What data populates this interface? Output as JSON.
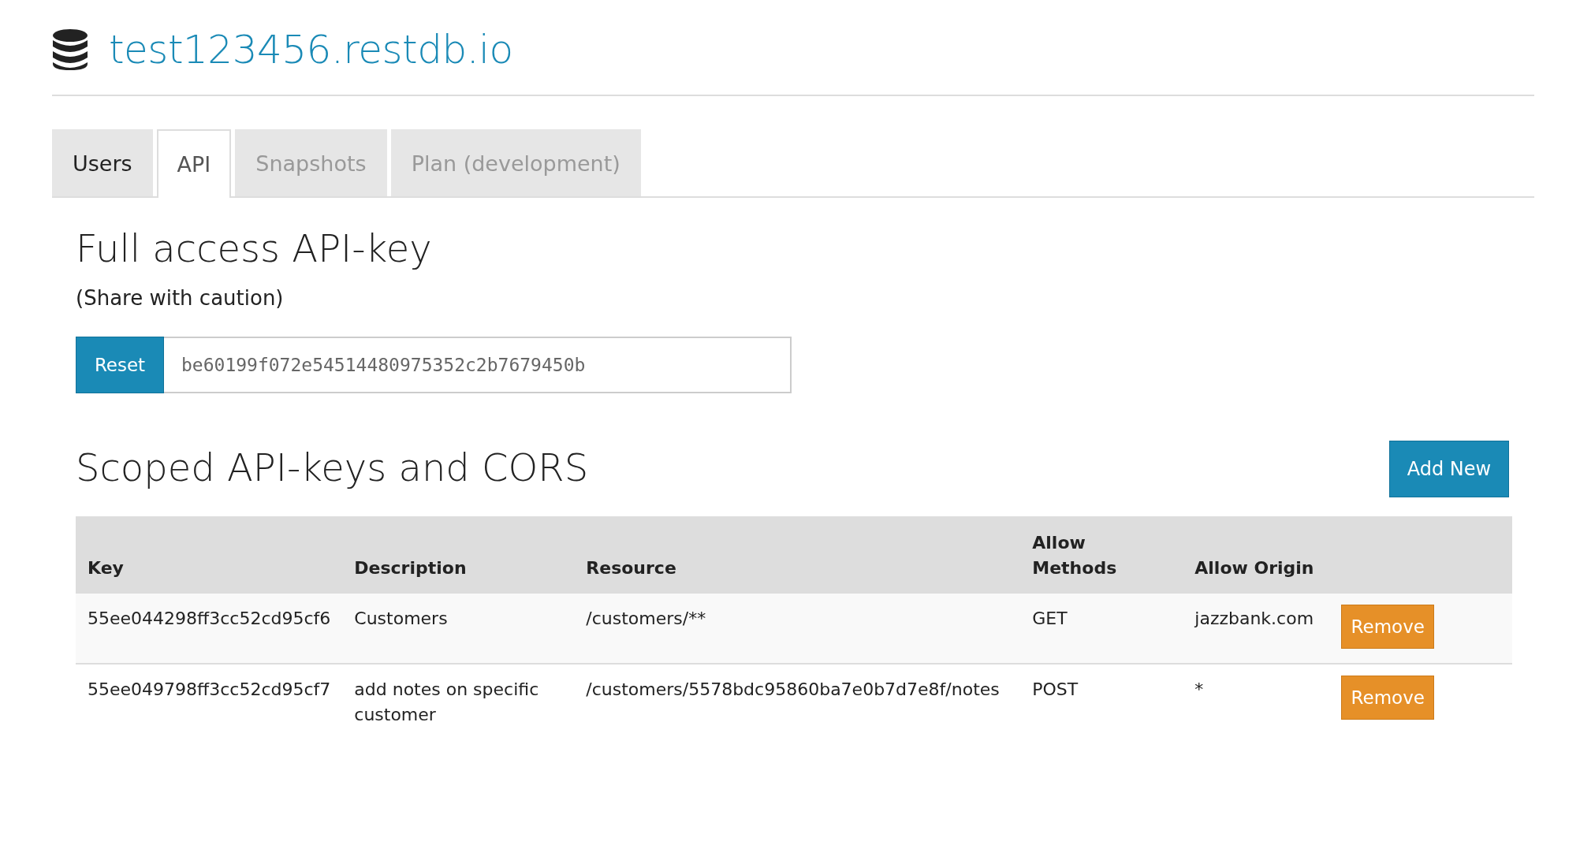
{
  "header": {
    "title": "test123456.restdb.io"
  },
  "tabs": [
    {
      "label": "Users",
      "selected": false,
      "disabled": false
    },
    {
      "label": "API",
      "selected": true,
      "disabled": false
    },
    {
      "label": "Snapshots",
      "selected": false,
      "disabled": true
    },
    {
      "label": "Plan (development)",
      "selected": false,
      "disabled": true
    }
  ],
  "full_access": {
    "heading": "Full access API-key",
    "note": "(Share with caution)",
    "reset_button": "Reset",
    "key_value": "be60199f072e54514480975352c2b7679450b"
  },
  "scoped": {
    "heading": "Scoped API-keys and CORS",
    "add_button": "Add New",
    "table": {
      "columns": [
        "Key",
        "Description",
        "Resource",
        "Allow\nMethods",
        "Allow Origin"
      ],
      "rows": [
        {
          "cells": [
            "55ee044298ff3cc52cd95cf6",
            "Customers",
            "/customers/**",
            "GET",
            "jazzbank.com"
          ],
          "action": "Remove"
        },
        {
          "cells": [
            "55ee049798ff3cc52cd95cf7",
            "add notes on specific customer",
            "/customers/5578bdc95860ba7e0b7d7e8f/notes",
            "POST",
            "*"
          ],
          "action": "Remove"
        }
      ]
    }
  }
}
